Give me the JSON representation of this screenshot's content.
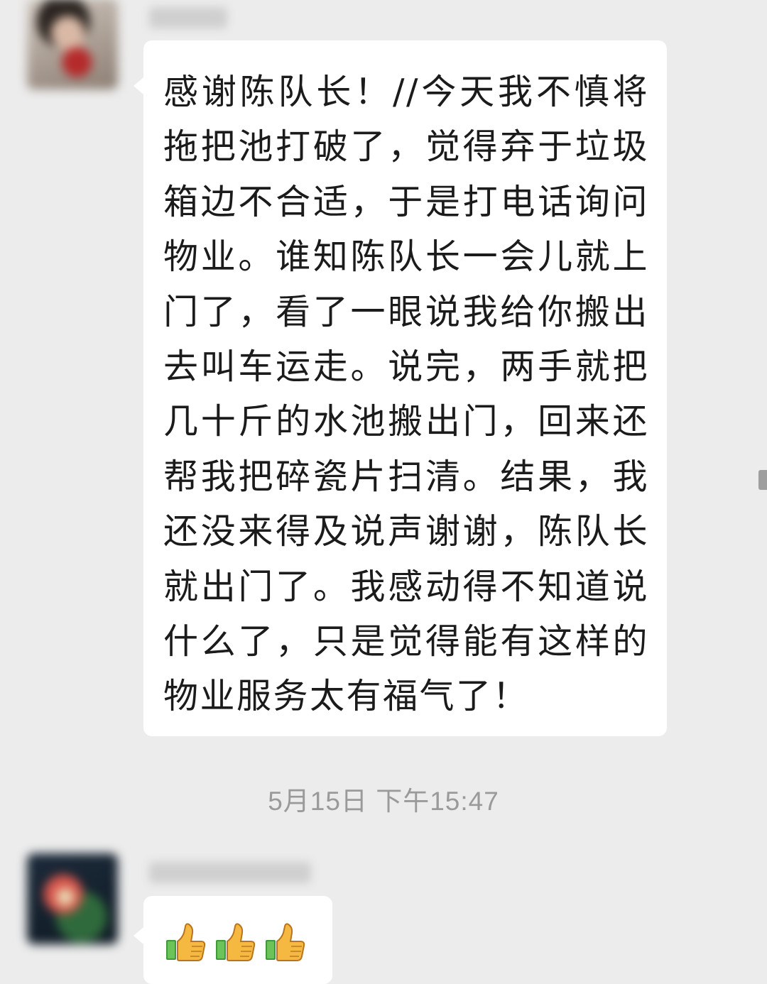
{
  "messages": [
    {
      "sender": "",
      "text": "感谢陈队长！//今天我不慎将拖把池打破了，觉得弃于垃圾箱边不合适，于是打电话询问物业。谁知陈队长一会儿就上门了，看了一眼说我给你搬出去叫车运走。说完，两手就把几十斤的水池搬出门，回来还帮我把碎瓷片扫清。结果，我还没来得及说声谢谢，陈队长就出门了。我感动得不知道说什么了，只是觉得能有这样的物业服务太有福气了！"
    },
    {
      "sender": "",
      "reactions": [
        "thumbs-up-icon",
        "thumbs-up-icon",
        "thumbs-up-icon"
      ]
    }
  ],
  "timestamp": "5月15日 下午15:47",
  "colors": {
    "background": "#ececec",
    "bubble": "#ffffff",
    "text": "#1b1b1b",
    "timestamp": "#9a9a9a"
  }
}
